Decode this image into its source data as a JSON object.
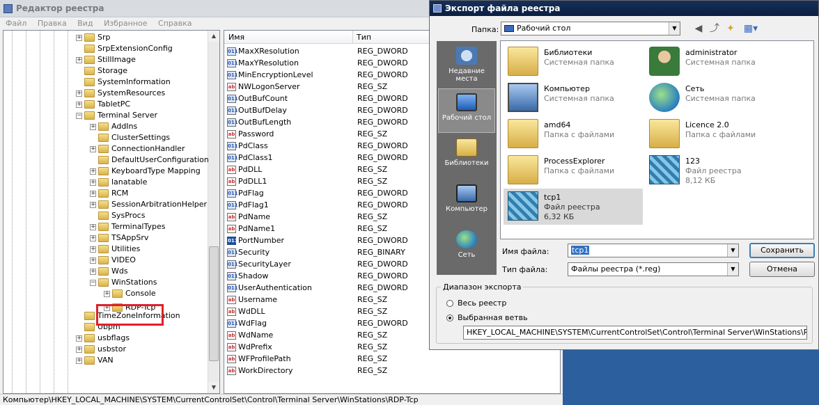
{
  "regedit": {
    "title": "Редактор реестра",
    "menu": [
      "Файл",
      "Правка",
      "Вид",
      "Избранное",
      "Справка"
    ],
    "tree": [
      {
        "label": "Srp",
        "expander": "+",
        "level": 1
      },
      {
        "label": "SrpExtensionConfig",
        "expander": "",
        "level": 1
      },
      {
        "label": "StillImage",
        "expander": "+",
        "level": 1
      },
      {
        "label": "Storage",
        "expander": "",
        "level": 1
      },
      {
        "label": "SystemInformation",
        "expander": "",
        "level": 1
      },
      {
        "label": "SystemResources",
        "expander": "+",
        "level": 1
      },
      {
        "label": "TabletPC",
        "expander": "+",
        "level": 1
      },
      {
        "label": "Terminal Server",
        "expander": "−",
        "level": 1
      },
      {
        "label": "AddIns",
        "expander": "+",
        "level": 2
      },
      {
        "label": "ClusterSettings",
        "expander": "",
        "level": 2
      },
      {
        "label": "ConnectionHandler",
        "expander": "+",
        "level": 2
      },
      {
        "label": "DefaultUserConfiguration",
        "expander": "",
        "level": 2
      },
      {
        "label": "KeyboardType Mapping",
        "expander": "+",
        "level": 2
      },
      {
        "label": "lanatable",
        "expander": "+",
        "level": 2
      },
      {
        "label": "RCM",
        "expander": "+",
        "level": 2
      },
      {
        "label": "SessionArbitrationHelper",
        "expander": "+",
        "level": 2
      },
      {
        "label": "SysProcs",
        "expander": "",
        "level": 2
      },
      {
        "label": "TerminalTypes",
        "expander": "+",
        "level": 2
      },
      {
        "label": "TSAppSrv",
        "expander": "+",
        "level": 2
      },
      {
        "label": "Utilities",
        "expander": "+",
        "level": 2
      },
      {
        "label": "VIDEO",
        "expander": "+",
        "level": 2
      },
      {
        "label": "Wds",
        "expander": "+",
        "level": 2
      },
      {
        "label": "WinStations",
        "expander": "−",
        "level": 2
      },
      {
        "label": "Console",
        "expander": "+",
        "level": 3
      },
      {
        "label": "RDP-Tcp",
        "expander": "+",
        "level": 3,
        "highlighted": true
      },
      {
        "label": "TimeZoneInformation",
        "expander": "",
        "level": 1
      },
      {
        "label": "Ubpm",
        "expander": "",
        "level": 1
      },
      {
        "label": "usbflags",
        "expander": "+",
        "level": 1
      },
      {
        "label": "usbstor",
        "expander": "+",
        "level": 1
      },
      {
        "label": "VAN",
        "expander": "+",
        "level": 1
      }
    ],
    "list_headers": {
      "name": "Имя",
      "type": "Тип"
    },
    "values": [
      {
        "name": "MaxXResolution",
        "type": "REG_DWORD",
        "kind": "bin"
      },
      {
        "name": "MaxYResolution",
        "type": "REG_DWORD",
        "kind": "bin"
      },
      {
        "name": "MinEncryptionLevel",
        "type": "REG_DWORD",
        "kind": "bin"
      },
      {
        "name": "NWLogonServer",
        "type": "REG_SZ",
        "kind": "sz"
      },
      {
        "name": "OutBufCount",
        "type": "REG_DWORD",
        "kind": "bin"
      },
      {
        "name": "OutBufDelay",
        "type": "REG_DWORD",
        "kind": "bin"
      },
      {
        "name": "OutBufLength",
        "type": "REG_DWORD",
        "kind": "bin"
      },
      {
        "name": "Password",
        "type": "REG_SZ",
        "kind": "sz"
      },
      {
        "name": "PdClass",
        "type": "REG_DWORD",
        "kind": "bin"
      },
      {
        "name": "PdClass1",
        "type": "REG_DWORD",
        "kind": "bin"
      },
      {
        "name": "PdDLL",
        "type": "REG_SZ",
        "kind": "sz"
      },
      {
        "name": "PdDLL1",
        "type": "REG_SZ",
        "kind": "sz"
      },
      {
        "name": "PdFlag",
        "type": "REG_DWORD",
        "kind": "bin"
      },
      {
        "name": "PdFlag1",
        "type": "REG_DWORD",
        "kind": "bin"
      },
      {
        "name": "PdName",
        "type": "REG_SZ",
        "kind": "sz"
      },
      {
        "name": "PdName1",
        "type": "REG_SZ",
        "kind": "sz"
      },
      {
        "name": "PortNumber",
        "type": "REG_DWORD",
        "kind": "sel"
      },
      {
        "name": "Security",
        "type": "REG_BINARY",
        "kind": "bin"
      },
      {
        "name": "SecurityLayer",
        "type": "REG_DWORD",
        "kind": "bin"
      },
      {
        "name": "Shadow",
        "type": "REG_DWORD",
        "kind": "bin"
      },
      {
        "name": "UserAuthentication",
        "type": "REG_DWORD",
        "kind": "bin"
      },
      {
        "name": "Username",
        "type": "REG_SZ",
        "kind": "sz"
      },
      {
        "name": "WdDLL",
        "type": "REG_SZ",
        "kind": "sz"
      },
      {
        "name": "WdFlag",
        "type": "REG_DWORD",
        "kind": "bin"
      },
      {
        "name": "WdName",
        "type": "REG_SZ",
        "kind": "sz"
      },
      {
        "name": "WdPrefix",
        "type": "REG_SZ",
        "kind": "sz"
      },
      {
        "name": "WFProfilePath",
        "type": "REG_SZ",
        "kind": "sz"
      },
      {
        "name": "WorkDirectory",
        "type": "REG_SZ",
        "kind": "sz"
      }
    ],
    "status": "Компьютер\\HKEY_LOCAL_MACHINE\\SYSTEM\\CurrentControlSet\\Control\\Terminal Server\\WinStations\\RDP-Tcp"
  },
  "dialog": {
    "title": "Экспорт файла реестра",
    "lookin_label": "Папка:",
    "lookin_value": "Рабочий стол",
    "places": [
      {
        "label": "Недавние места",
        "icon": "recent-places-icon"
      },
      {
        "label": "Рабочий стол",
        "icon": "desktop-icon",
        "active": true
      },
      {
        "label": "Библиотеки",
        "icon": "libraries-icon"
      },
      {
        "label": "Компьютер",
        "icon": "computer-icon"
      },
      {
        "label": "Сеть",
        "icon": "network-icon"
      }
    ],
    "files": [
      {
        "name": "Библиотеки",
        "desc": "Системная папка",
        "desc2": "",
        "icon": "libraries-icon",
        "kind": "folder"
      },
      {
        "name": "administrator",
        "desc": "Системная папка",
        "desc2": "",
        "icon": "user-folder-icon",
        "kind": "user"
      },
      {
        "name": "Компьютер",
        "desc": "Системная папка",
        "desc2": "",
        "icon": "computer-icon",
        "kind": "pc"
      },
      {
        "name": "Сеть",
        "desc": "Системная папка",
        "desc2": "",
        "icon": "network-icon",
        "kind": "net"
      },
      {
        "name": "amd64",
        "desc": "Папка с файлами",
        "desc2": "",
        "icon": "folder-icon",
        "kind": "folder"
      },
      {
        "name": "Licence 2.0",
        "desc": "Папка с файлами",
        "desc2": "",
        "icon": "folder-icon",
        "kind": "folder"
      },
      {
        "name": "ProcessExplorer",
        "desc": "Папка с файлами",
        "desc2": "",
        "icon": "folder-icon",
        "kind": "folder"
      },
      {
        "name": "123",
        "desc": "Файл реестра",
        "desc2": "8,12 КБ",
        "icon": "registry-file-icon",
        "kind": "reg"
      },
      {
        "name": "tcp1",
        "desc": "Файл реестра",
        "desc2": "6,32 КБ",
        "icon": "registry-file-icon",
        "kind": "reg",
        "selected": true
      }
    ],
    "filename_label": "Имя файла:",
    "filename_value": "tcp1",
    "filetype_label": "Тип файла:",
    "filetype_value": "Файлы реестра (*.reg)",
    "save_label": "Сохранить",
    "cancel_label": "Отмена",
    "range_title": "Диапазон экспорта",
    "range_all": "Весь реестр",
    "range_branch": "Выбранная ветвь",
    "range_selected": "branch",
    "branch_path": "HKEY_LOCAL_MACHINE\\SYSTEM\\CurrentControlSet\\Control\\Terminal Server\\WinStations\\RDP-Tcp"
  }
}
